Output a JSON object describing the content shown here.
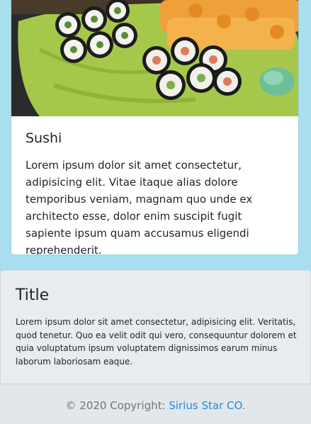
{
  "card": {
    "image_alt": "sushi-platter-photo",
    "title": "Sushi",
    "text": "Lorem ipsum dolor sit amet consectetur, adipisicing elit. Vitae itaque alias dolore temporibus veniam, magnam quo unde ex architecto esse, dolor enim suscipit fugit sapiente ipsum quam accusamus eligendi reprehenderit."
  },
  "section": {
    "title": "Title",
    "text": "Lorem ipsum dolor sit amet consectetur, adipisicing elit. Veritatis, quod tenetur. Quo ea velit odit qui vero, consequuntur dolorem et quia voluptatum ipsum voluptatem dignissimos earum minus laborum laboriosam eaque."
  },
  "footer": {
    "copyright": "© 2020 Copyright: ",
    "link_label": "Sirius Star CO."
  },
  "colors": {
    "page_background": "#a9deef",
    "link": "#1a8fe3",
    "plate": "#a6c84a"
  }
}
